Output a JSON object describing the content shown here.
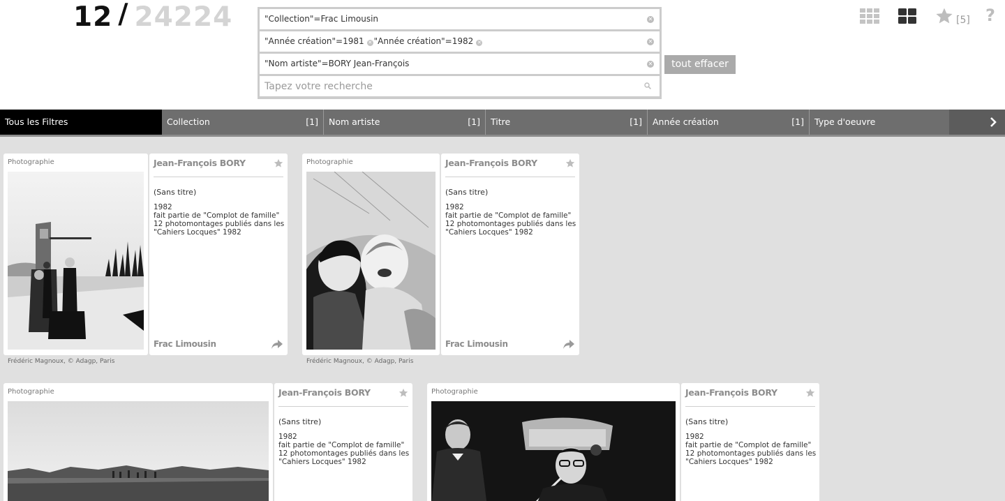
{
  "counter": {
    "current": "12",
    "separator": "/",
    "total": "24224"
  },
  "search": {
    "chips": [
      {
        "text": "\"Collection\"=Frac Limousin"
      },
      {
        "parts": [
          "\"Année création\"=1981",
          "\"Année création\"=1982"
        ]
      },
      {
        "text": "\"Nom artiste\"=BORY Jean-François"
      }
    ],
    "placeholder": "Tapez votre recherche",
    "clear_label": "tout effacer"
  },
  "toolbar": {
    "icons": [
      "grid-small-icon",
      "grid-large-icon",
      "star-icon",
      "help-icon"
    ],
    "favorites_count": "[5]",
    "help_label": "?"
  },
  "filters": {
    "items": [
      {
        "label": "Tous les Filtres",
        "count": ""
      },
      {
        "label": "Collection",
        "count": "[1]"
      },
      {
        "label": "Nom artiste",
        "count": "[1]"
      },
      {
        "label": "Titre",
        "count": "[1]"
      },
      {
        "label": "Année création",
        "count": "[1]"
      },
      {
        "label": "Type d'oeuvre",
        "count": ""
      }
    ]
  },
  "cards": [
    {
      "type": "Photographie",
      "artist": "Jean-François BORY",
      "title": "(Sans titre)",
      "desc": [
        "1982",
        "fait partie de \"Complot de famille\"",
        "12 photomontages publiés dans les",
        "\"Cahiers Locques\" 1982"
      ],
      "collection": "Frac Limousin",
      "credit": "Frédéric Magnoux, © Adagp, Paris"
    },
    {
      "type": "Photographie",
      "artist": "Jean-François BORY",
      "title": "(Sans titre)",
      "desc": [
        "1982",
        "fait partie de \"Complot de famille\"",
        "12 photomontages publiés dans les",
        "\"Cahiers Locques\" 1982"
      ],
      "collection": "Frac Limousin",
      "credit": "Frédéric Magnoux, © Adagp, Paris"
    },
    {
      "type": "Photographie",
      "artist": "Jean-François BORY",
      "title": "(Sans titre)",
      "desc": [
        "1982",
        "fait partie de \"Complot de famille\"",
        "12 photomontages publiés dans les",
        "\"Cahiers Locques\" 1982"
      ]
    },
    {
      "type": "Photographie",
      "artist": "Jean-François BORY",
      "title": "(Sans titre)",
      "desc": [
        "1982",
        "fait partie de \"Complot de famille\"",
        "12 photomontages publiés dans les",
        "\"Cahiers Locques\" 1982"
      ]
    }
  ]
}
